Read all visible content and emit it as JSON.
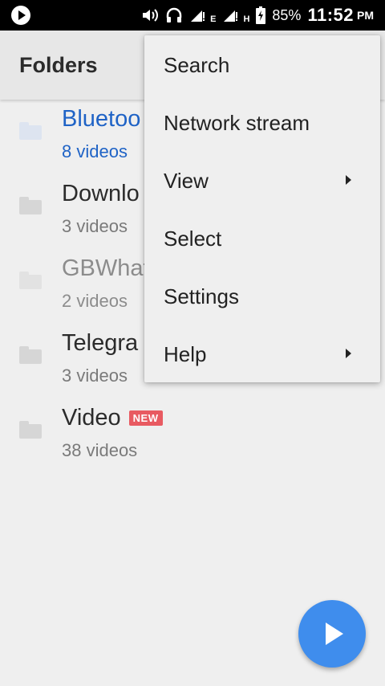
{
  "status_bar": {
    "battery": "85%",
    "time": "11:52",
    "ampm": "PM",
    "signal1_type": "E",
    "signal2_type": "H"
  },
  "app_bar": {
    "title": "Folders"
  },
  "folders": [
    {
      "name": "Bluetoo",
      "count": "8 videos",
      "color": "#1f63c6",
      "icon_color": "#dde4f0",
      "count_color": "#1f63c6"
    },
    {
      "name": "Downlo",
      "count": "3 videos",
      "color": "#2b2b2b",
      "icon_color": "#d6d6d6",
      "count_color": "#7a7a7a"
    },
    {
      "name": "GBWhat",
      "count": "2 videos",
      "color": "#8c8c8c",
      "icon_color": "#e2e2e2",
      "count_color": "#8c8c8c"
    },
    {
      "name": "Telegra",
      "count": "3 videos",
      "color": "#2b2b2b",
      "icon_color": "#d6d6d6",
      "count_color": "#7a7a7a"
    },
    {
      "name": "Video",
      "count": "38 videos",
      "color": "#2b2b2b",
      "icon_color": "#d6d6d6",
      "count_color": "#7a7a7a",
      "badge": "NEW"
    }
  ],
  "menu": {
    "items": [
      {
        "label": "Search"
      },
      {
        "label": "Network stream"
      },
      {
        "label": "View",
        "submenu": true
      },
      {
        "label": "Select"
      },
      {
        "label": "Settings"
      },
      {
        "label": "Help",
        "submenu": true
      }
    ]
  },
  "fab": {
    "icon": "play-icon",
    "color": "#3f8ded"
  }
}
